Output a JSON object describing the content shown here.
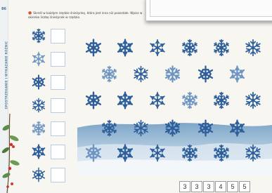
{
  "page": {
    "number": "86",
    "side_title": "SPOSTRZEGANIE I WYKAZANIE RÓŻNIC",
    "instruction": "Skreśl w każdym rzędzie śnieżynkę, która jest inna niż pozostałe. Wpisz w okienko liczbę śnieżynek w rzędzie."
  },
  "colors": {
    "flake": "#2e5f9a",
    "flake_light": "#6f96c2",
    "accent": "#e0523f"
  },
  "answer_icons": [
    "snowflake-icon-a",
    "snowflake-icon-b",
    "snowflake-icon-c",
    "snowflake-icon-d",
    "snowflake-icon-e",
    "snowflake-icon-f",
    "snowflake-icon-g"
  ],
  "number_strip": [
    "3",
    "3",
    "3",
    "4",
    "5",
    "5"
  ]
}
